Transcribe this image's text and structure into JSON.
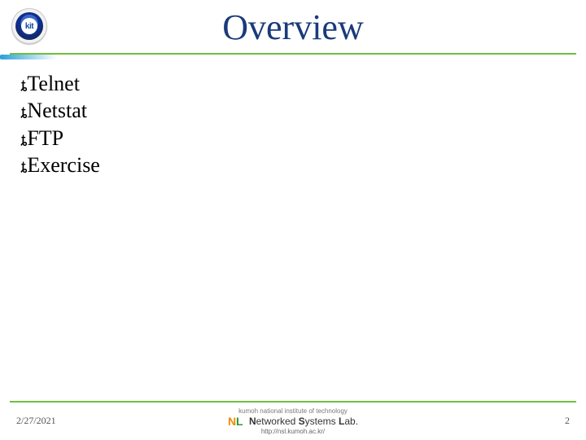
{
  "title": "Overview",
  "logo": {
    "abbrev": "kit"
  },
  "bullets": [
    {
      "text": "Telnet"
    },
    {
      "text": "Netstat"
    },
    {
      "text": "FTP"
    },
    {
      "text": "Exercise"
    }
  ],
  "footer": {
    "date": "2/27/2021",
    "institute": "kumoh national institute of technology",
    "lab_name_html": "Networked Systems Lab.",
    "url": "http://nsl.kumoh.ac.kr/",
    "page_number": "2"
  }
}
